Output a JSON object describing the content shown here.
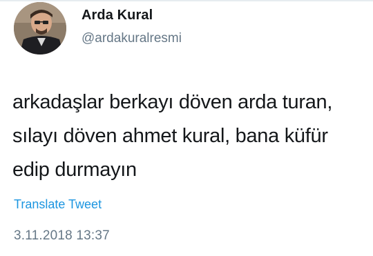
{
  "tweet": {
    "author": {
      "display_name": "Arda Kural",
      "handle": "@ardakuralresmi",
      "avatar_icon": "profile-photo"
    },
    "text_lines": [
      "arkadaşlar berkayı döven arda turan,",
      "sılayı döven ahmet kural, bana küfür",
      "edip durmayın"
    ],
    "translate_label": "Translate Tweet",
    "timestamp": "3.11.2018 13:37"
  },
  "colors": {
    "text": "#14171a",
    "secondary": "#657786",
    "link": "#1b95e0",
    "background": "#ffffff"
  }
}
